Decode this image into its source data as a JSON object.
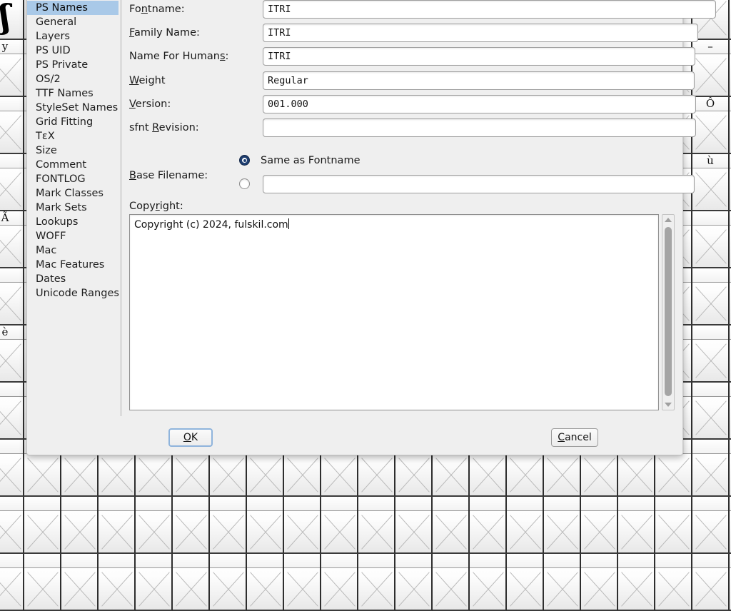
{
  "background": {
    "app": "fontforge-font-view",
    "glyph_cells_left": [
      {
        "label": "",
        "glyph": "ʃ",
        "empty": false
      },
      {
        "label": "y",
        "glyph": "",
        "empty": true
      },
      {
        "label": "",
        "glyph": "",
        "empty": true
      },
      {
        "label": "",
        "glyph": "",
        "empty": true
      },
      {
        "label": "Ã",
        "glyph": "",
        "empty": true
      },
      {
        "label": "",
        "glyph": "",
        "empty": true
      },
      {
        "label": "è",
        "glyph": "",
        "empty": true
      },
      {
        "label": "",
        "glyph": "",
        "empty": true
      },
      {
        "label": "",
        "glyph": "",
        "empty": true
      }
    ],
    "glyph_cells_right": [
      {
        "label": "",
        "glyph": "",
        "empty": true
      },
      {
        "label": "–",
        "glyph": "",
        "empty": true
      },
      {
        "label": "Ô",
        "glyph": "",
        "empty": true
      },
      {
        "label": "ù",
        "glyph": "",
        "empty": true
      },
      {
        "label": "",
        "glyph": "",
        "empty": true
      },
      {
        "label": "",
        "glyph": "",
        "empty": true
      },
      {
        "label": "",
        "glyph": "",
        "empty": true
      },
      {
        "label": "",
        "glyph": "",
        "empty": true
      },
      {
        "label": "",
        "glyph": "",
        "empty": true
      }
    ]
  },
  "dialog": {
    "sidebar": {
      "selected_index": 0,
      "items": [
        {
          "label": "PS Names"
        },
        {
          "label": "General"
        },
        {
          "label": "Layers"
        },
        {
          "label": "PS UID"
        },
        {
          "label": "PS Private"
        },
        {
          "label": "OS/2"
        },
        {
          "label": "TTF Names"
        },
        {
          "label": "StyleSet Names"
        },
        {
          "label": "Grid Fitting"
        },
        {
          "label": "TεX"
        },
        {
          "label": "Size"
        },
        {
          "label": "Comment"
        },
        {
          "label": "FONTLOG"
        },
        {
          "label": "Mark Classes"
        },
        {
          "label": "Mark Sets"
        },
        {
          "label": "Lookups"
        },
        {
          "label": "WOFF"
        },
        {
          "label": "Mac"
        },
        {
          "label": "Mac Features"
        },
        {
          "label": "Dates"
        },
        {
          "label": "Unicode Ranges"
        }
      ]
    },
    "fields": {
      "fontname": {
        "label_pre": "Fo",
        "label_accel": "n",
        "label_post": "tname:",
        "value": "ITRI",
        "placeholder": ""
      },
      "family_name": {
        "label_pre": "",
        "label_accel": "F",
        "label_post": "amily Name:",
        "value": "ITRI",
        "placeholder": ""
      },
      "name_for_humans": {
        "label_pre": "Name For Human",
        "label_accel": "s",
        "label_post": ":",
        "value": "ITRI",
        "placeholder": ""
      },
      "weight": {
        "label_pre": "",
        "label_accel": "W",
        "label_post": "eight",
        "value": "Regular",
        "placeholder": ""
      },
      "version": {
        "label_pre": "",
        "label_accel": "V",
        "label_post": "ersion:",
        "value": "001.000",
        "placeholder": ""
      },
      "sfnt_revision": {
        "label_pre": "sfnt ",
        "label_accel": "R",
        "label_post": "evision:",
        "value": "",
        "placeholder": ""
      },
      "base_filename": {
        "label_pre": "",
        "label_accel": "B",
        "label_post": "ase Filename:",
        "radio_same_label": "Same as Fontname",
        "radio_same_selected": true,
        "radio_custom_selected": false,
        "custom_value": "",
        "placeholder": ""
      },
      "copyright": {
        "label_pre": "Copy",
        "label_accel": "r",
        "label_post": "ight:",
        "value": "Copyright (c) 2024, fulskil.com"
      }
    },
    "buttons": {
      "ok": {
        "pre": "",
        "accel": "O",
        "post": "K",
        "focused": true
      },
      "cancel": {
        "pre": "",
        "accel": "C",
        "post": "ancel",
        "focused": false
      }
    }
  },
  "colors": {
    "selection_blue": "#a9c9e8",
    "dialog_bg": "#efefef",
    "radio_on": "#1f3f72",
    "focus_ring": "#8fb4dc"
  }
}
